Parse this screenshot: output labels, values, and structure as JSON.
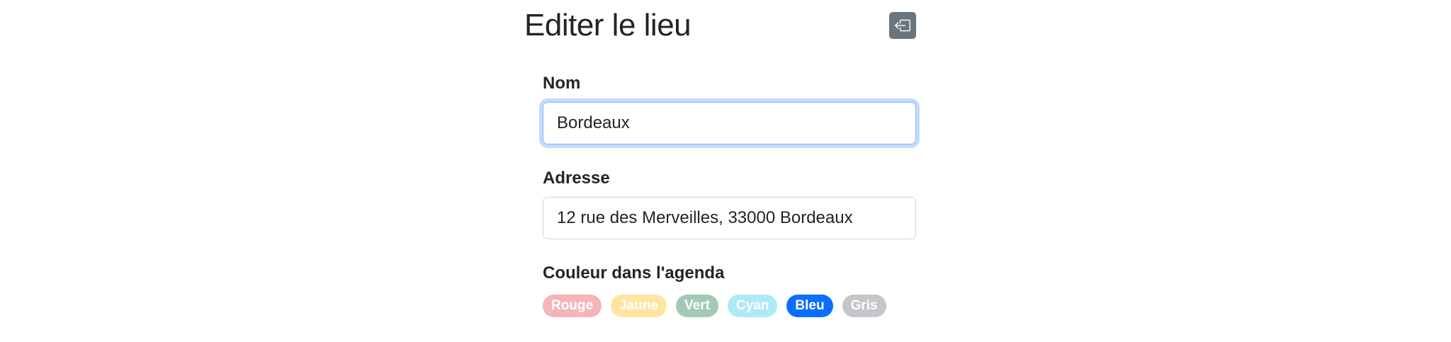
{
  "header": {
    "title": "Editer le lieu",
    "back_icon": "box-arrow-left-icon"
  },
  "form": {
    "name": {
      "label": "Nom",
      "value": "Bordeaux"
    },
    "address": {
      "label": "Adresse",
      "value": "12 rue des Merveilles, 33000 Bordeaux"
    },
    "color": {
      "label": "Couleur dans l'agenda",
      "options": [
        {
          "label": "Rouge",
          "color": "#f5b5b8",
          "selected": false
        },
        {
          "label": "Jaune",
          "color": "#ffe5a0",
          "selected": false
        },
        {
          "label": "Vert",
          "color": "#a3c9b4",
          "selected": false
        },
        {
          "label": "Cyan",
          "color": "#aee9f8",
          "selected": false
        },
        {
          "label": "Bleu",
          "color": "#0d6efd",
          "selected": true
        },
        {
          "label": "Gris",
          "color": "#c4c6c9",
          "selected": false
        }
      ]
    }
  },
  "colors": {
    "primary": "#0d6efd",
    "secondary_button": "#6c757d",
    "text": "#212529",
    "input_border": "#ced4da",
    "focus_border": "#86b7fe"
  }
}
